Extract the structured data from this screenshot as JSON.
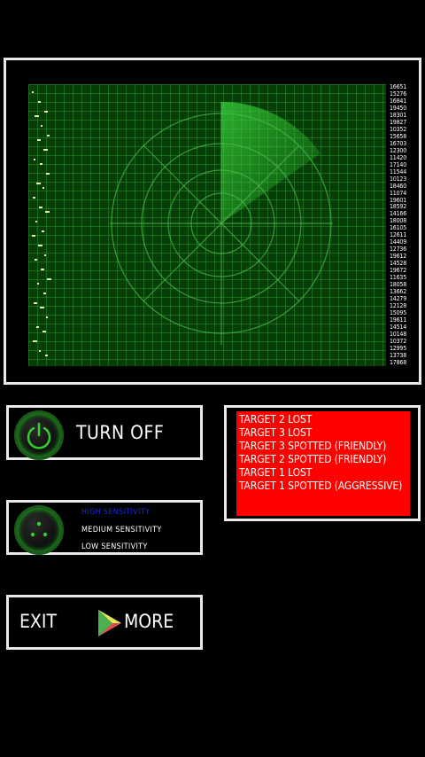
{
  "radar": {
    "readout": [
      "16651",
      "15276",
      "16841",
      "19450",
      "18301",
      "19827",
      "10352",
      "15658",
      "16703",
      "12300",
      "11420",
      "17140",
      "11544",
      "10123",
      "18460",
      "11074",
      "19601",
      "18592",
      "14166",
      "18008",
      "16105",
      "12611",
      "14409",
      "12736",
      "19612",
      "14528",
      "19672",
      "11635",
      "18058",
      "13662",
      "14279",
      "12128",
      "15095",
      "19611",
      "14514",
      "10148",
      "10372",
      "12995",
      "13738",
      "17868"
    ],
    "colors": {
      "screen": "#063d09",
      "grid": "#3cbe3c",
      "sweep": "#3ad43a"
    }
  },
  "power": {
    "label": "TURN OFF",
    "icon": "power-icon"
  },
  "sensitivity": {
    "options": [
      {
        "label": "HIGH SENSITIVITY",
        "selected": true
      },
      {
        "label": "MEDIUM SENSITIVITY",
        "selected": false
      },
      {
        "label": "LOW SENSITIVITY",
        "selected": false
      }
    ],
    "icon": "sensitivity-dots-icon"
  },
  "nav": {
    "exit_label": "EXIT",
    "more_label": "MORE",
    "more_icon": "play-store-icon"
  },
  "log": {
    "lines": [
      "TARGET 2 LOST",
      "TARGET 3 LOST",
      "TARGET 3 SPOTTED (FRIENDLY)",
      "TARGET 2 SPOTTED (FRIENDLY)",
      "TARGET 1 LOST",
      "TARGET 1 SPOTTED (AGGRESSIVE)"
    ],
    "colors": {
      "background": "#ff0000",
      "text": "#ffffff"
    }
  }
}
